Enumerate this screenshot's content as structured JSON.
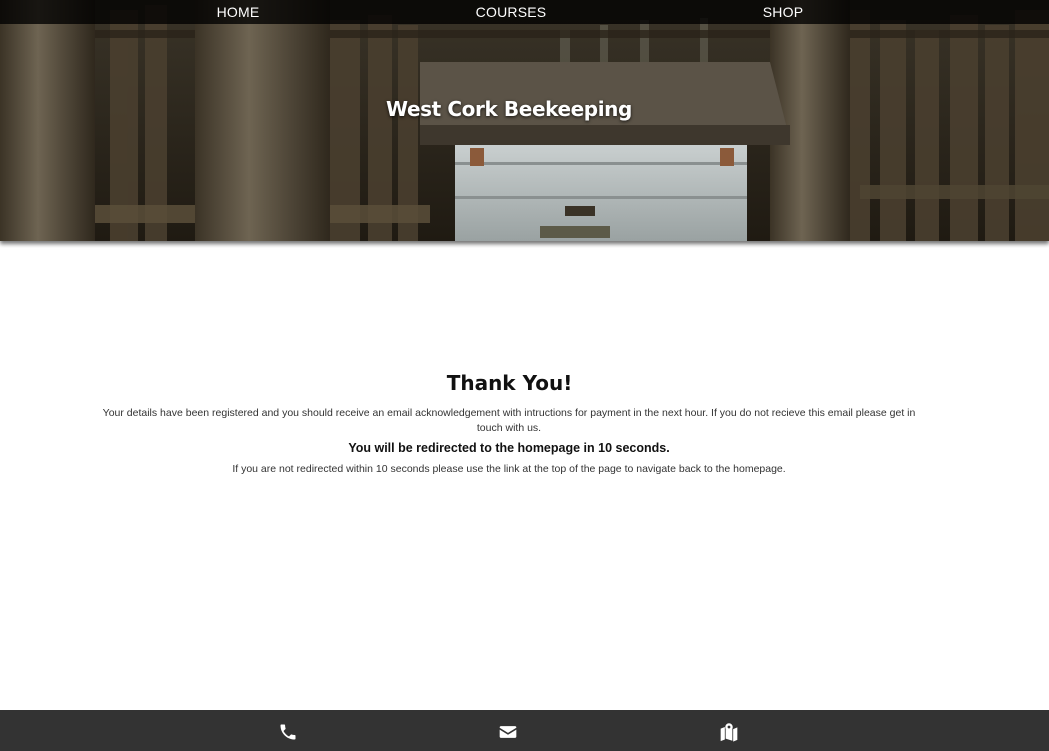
{
  "nav": {
    "items": [
      {
        "label": "HOME"
      },
      {
        "label": "COURSES"
      },
      {
        "label": "SHOP"
      }
    ]
  },
  "hero": {
    "title": "West Cork Beekeeping"
  },
  "main": {
    "heading": "Thank You!",
    "details": "Your details have been registered and you should receive an email acknowledgement with intructions for payment in the next hour. If you do not recieve this email please get in touch with us.",
    "redirect_message": "You will be redirected to the homepage in 10 seconds.",
    "fallback_message": "If you are not redirected within 10 seconds please use the link at the top of the page to navigate back to the homepage."
  },
  "footer": {
    "icons": [
      "phone-icon",
      "envelope-icon",
      "map-marker-icon"
    ]
  },
  "colors": {
    "footer_bg": "#333333",
    "nav_bg": "#000000",
    "text": "#111111"
  }
}
